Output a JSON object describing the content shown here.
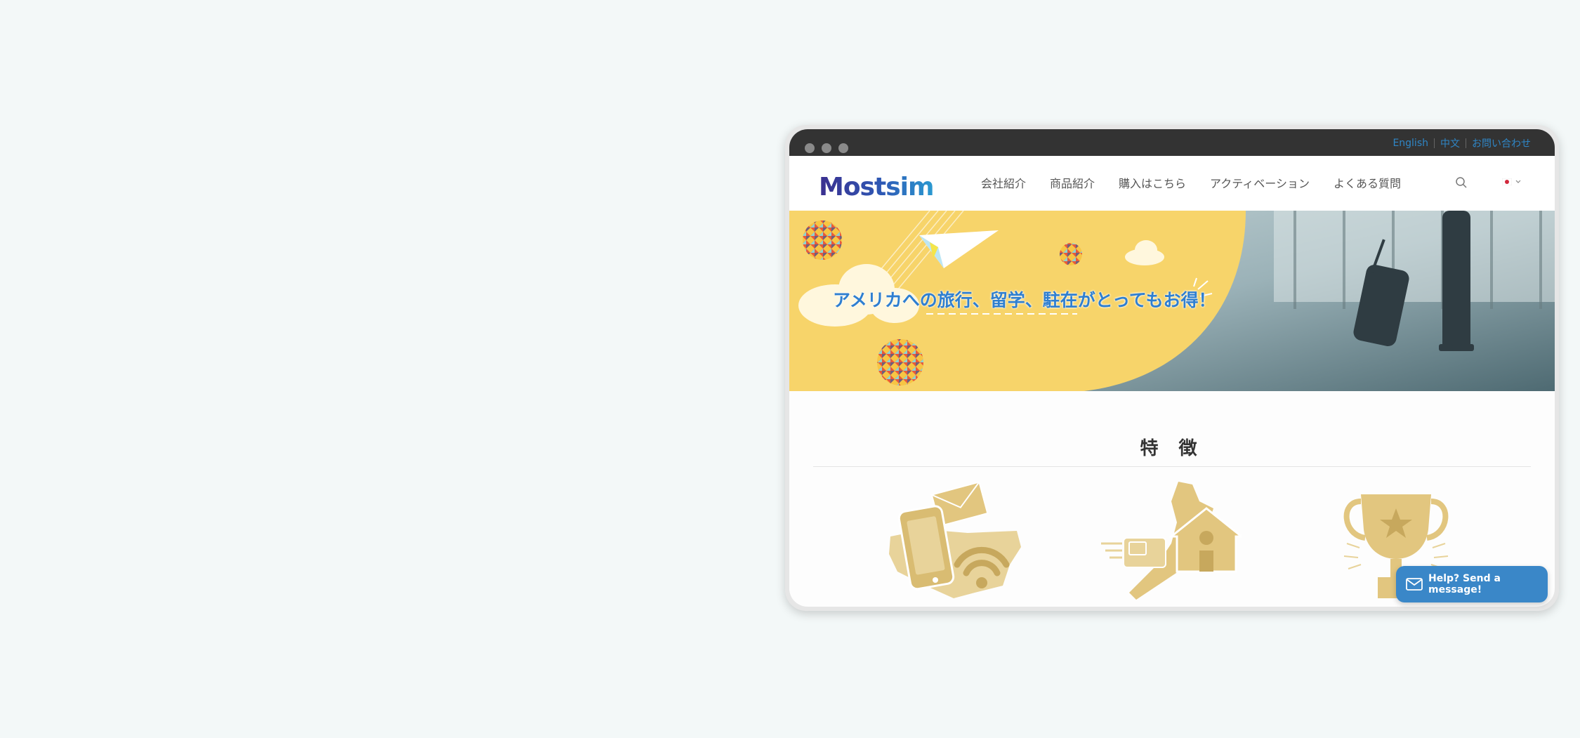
{
  "browser": {
    "top_links": [
      "English",
      "中文",
      "お問い合わせ"
    ]
  },
  "header": {
    "logo_text": "Mostsim",
    "nav": [
      "会社紹介",
      "商品紹介",
      "購入はこちら",
      "アクティベーション",
      "よくある質問"
    ],
    "language_flag": "japan-flag-icon"
  },
  "banner": {
    "headline": "アメリカへの旅行、留学、駐在がとってもお得！"
  },
  "features": {
    "title": "特 徴",
    "icons": [
      "phone-wifi-usa-icon",
      "sim-japan-house-icon",
      "trophy-icon"
    ]
  },
  "chat": {
    "label": "Help? Send a message!"
  },
  "colors": {
    "accent": "#2f86c6",
    "banner_yellow": "#f7d46a",
    "feature_gold": "#e2c67f",
    "topbar": "#333333",
    "chat_button": "#3a87c8"
  }
}
